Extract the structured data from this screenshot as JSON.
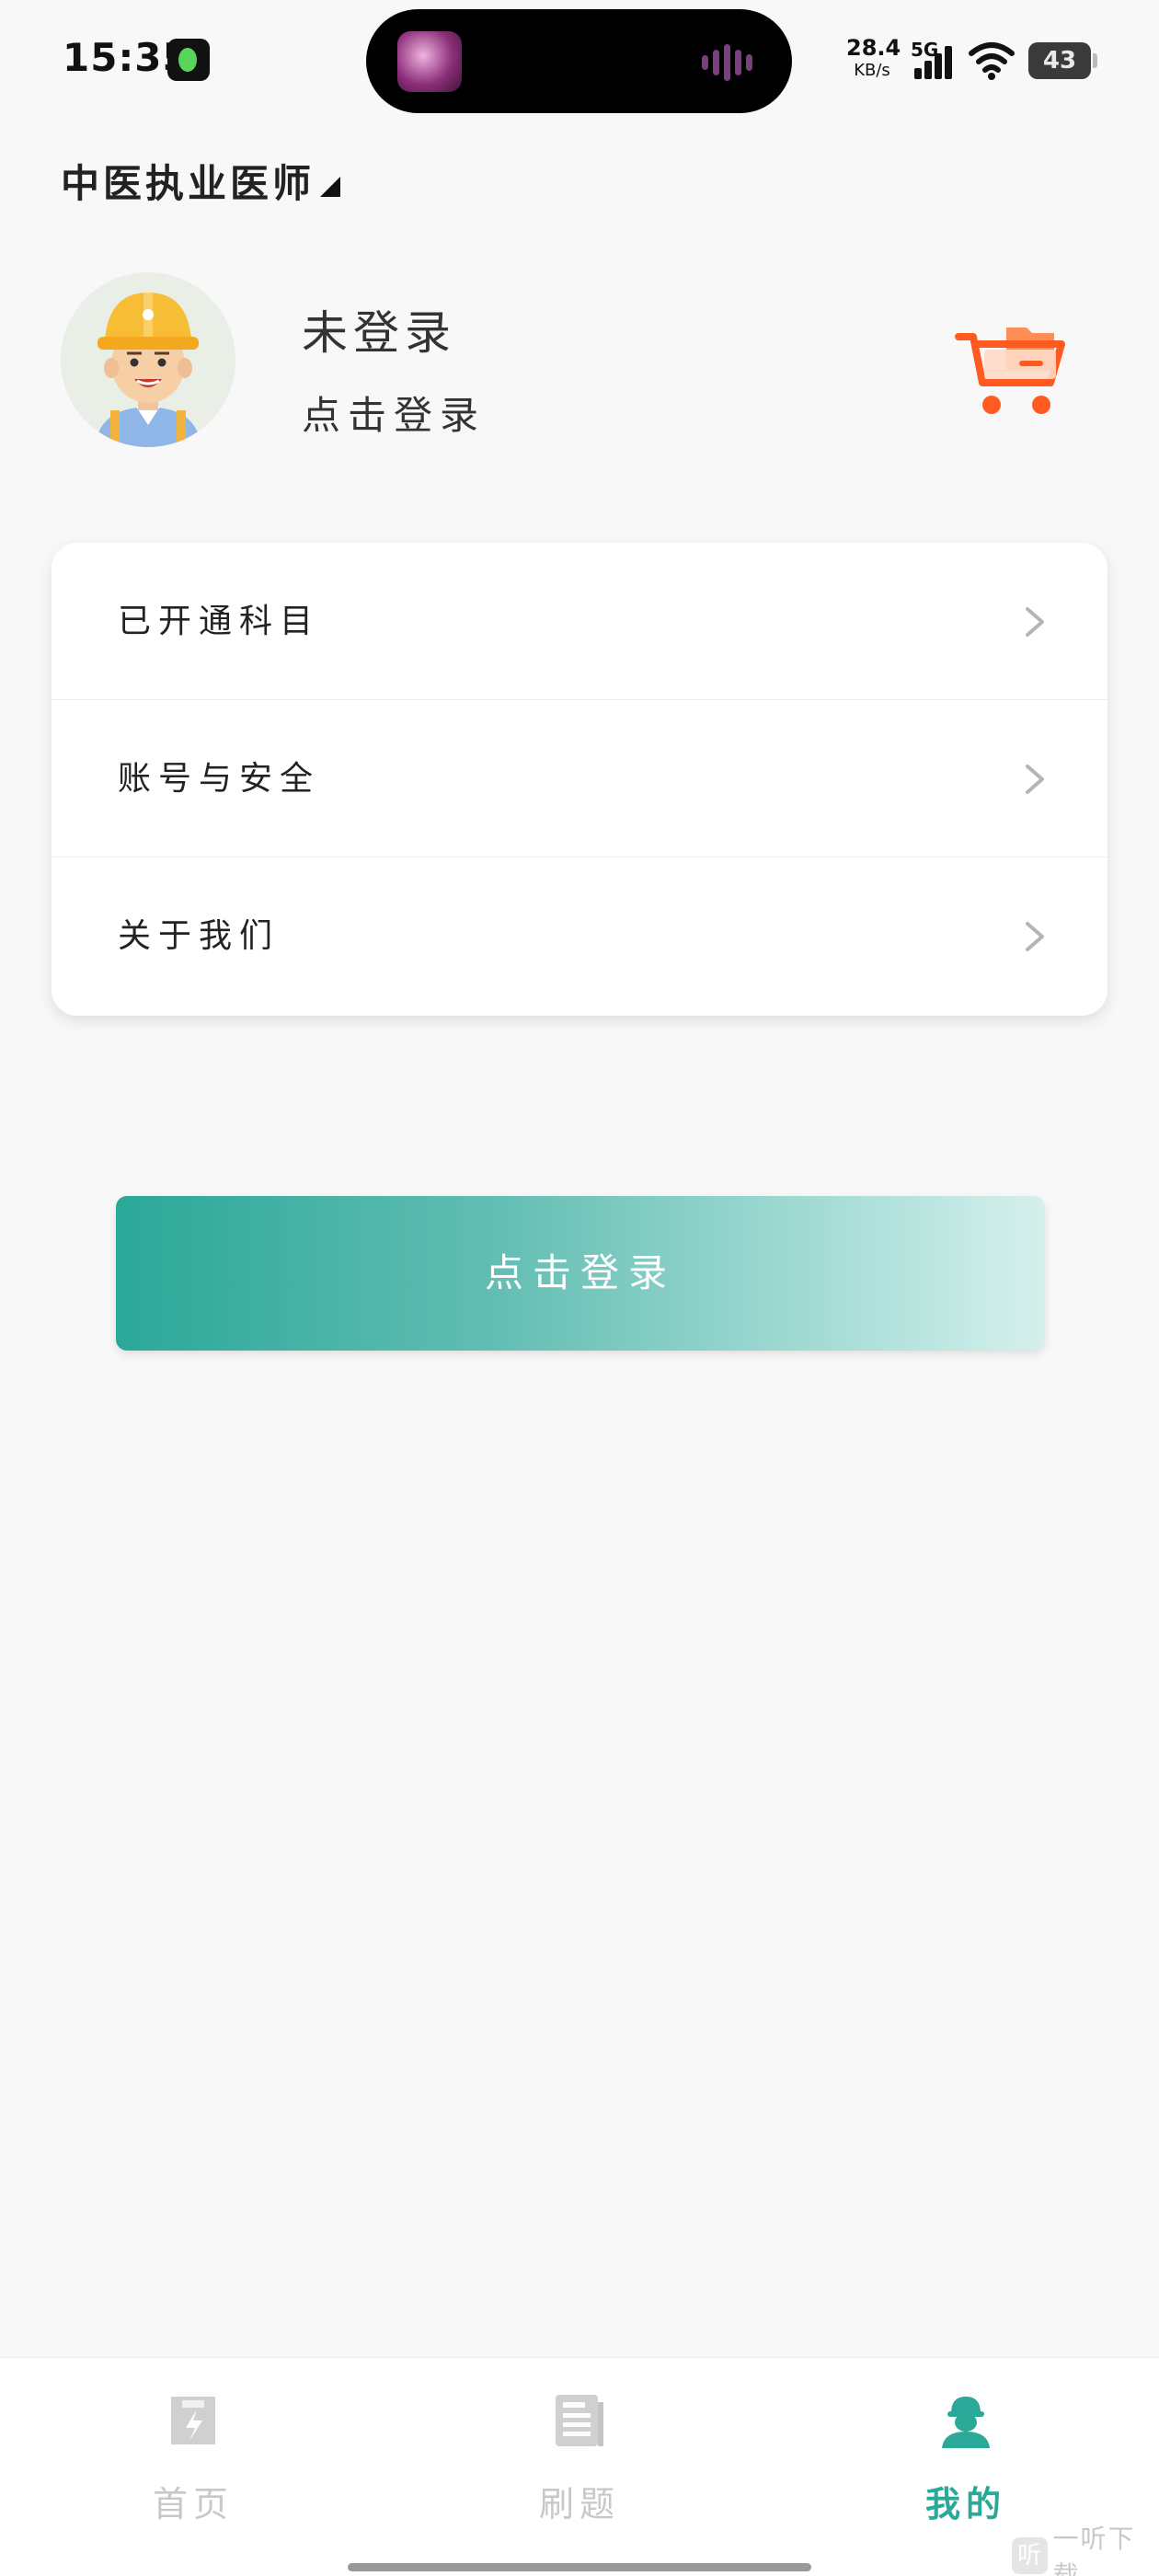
{
  "status_bar": {
    "time": "15:35",
    "net_speed_value": "28.4",
    "net_speed_unit": "KB/s",
    "network_type": "5G",
    "battery": "43"
  },
  "header": {
    "subject": "中医执业医师"
  },
  "profile": {
    "name": "未登录",
    "login_prompt": "点击登录"
  },
  "menu": {
    "items": [
      {
        "label": "已开通科目"
      },
      {
        "label": "账号与安全"
      },
      {
        "label": "关于我们"
      }
    ]
  },
  "login_button": {
    "label": "点击登录"
  },
  "bottom_nav": {
    "items": [
      {
        "label": "首页",
        "icon": "home-icon",
        "active": false
      },
      {
        "label": "刷题",
        "icon": "question-bank-icon",
        "active": false
      },
      {
        "label": "我的",
        "icon": "profile-icon",
        "active": true
      }
    ]
  },
  "watermark": {
    "text": "一听下载",
    "logo": "听"
  },
  "colors": {
    "accent": "#2aa898",
    "cart": "#ff5a1f",
    "inactive_nav": "#c8c8c8",
    "background": "#f8f8f8"
  }
}
